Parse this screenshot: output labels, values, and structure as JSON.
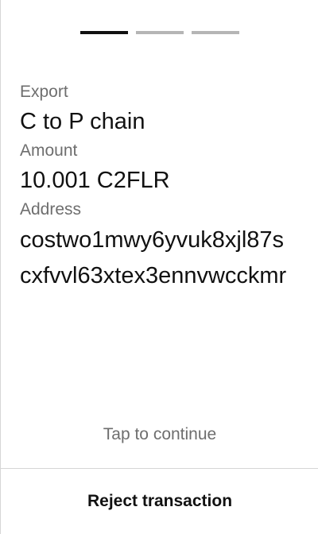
{
  "progress": {
    "total_steps": 3,
    "current_step": 1
  },
  "transaction": {
    "type_label": "Export",
    "type_value": "C to P chain",
    "amount_label": "Amount",
    "amount_value": "10.001 C2FLR",
    "address_label": "Address",
    "address_value": "costwo1mwy6yvuk8xjl87scxfvvl63xtex3ennvwcckmr"
  },
  "footer": {
    "tap_hint": "Tap to continue",
    "reject_label": "Reject transaction"
  },
  "colors": {
    "active_segment": "#111111",
    "inactive_segment": "#b5b5b5",
    "label_text": "#6e6e6e",
    "primary_text": "#111111"
  }
}
